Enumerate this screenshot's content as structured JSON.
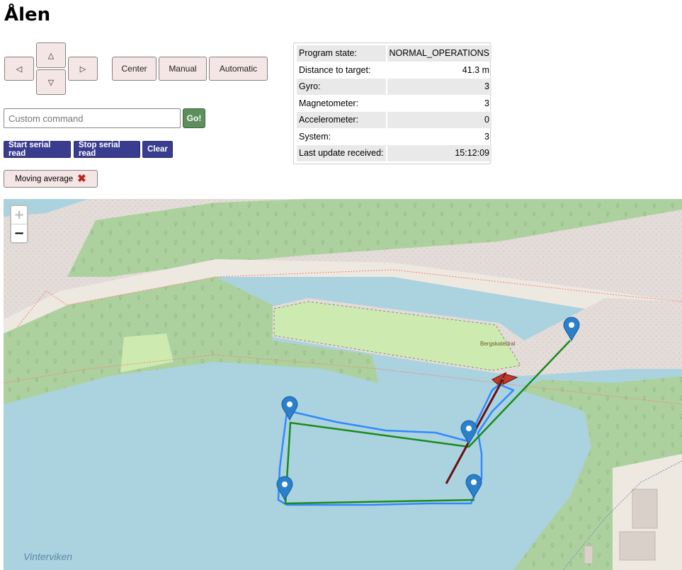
{
  "title": "Ålen",
  "controls": {
    "left_arrow": "◁",
    "up_arrow": "△",
    "down_arrow": "▽",
    "right_arrow": "▷",
    "center_label": "Center",
    "manual_label": "Manual",
    "automatic_label": "Automatic"
  },
  "command": {
    "placeholder": "Custom command",
    "go_label": "Go!"
  },
  "serial": {
    "start_label": "Start serial read",
    "stop_label": "Stop serial read",
    "clear_label": "Clear"
  },
  "moving_average": {
    "label": "Moving average",
    "icon": "close-icon"
  },
  "status": {
    "rows": [
      {
        "label": "Program state:",
        "value": "NORMAL_OPERATIONS"
      },
      {
        "label": "Distance to target:",
        "value": "41.3 m"
      },
      {
        "label": "Gyro:",
        "value": "3"
      },
      {
        "label": "Magnetometer:",
        "value": "3"
      },
      {
        "label": "Accelerometer:",
        "value": "0"
      },
      {
        "label": "System:",
        "value": "3"
      },
      {
        "label": "Last update received:",
        "value": "15:12:09"
      }
    ]
  },
  "map": {
    "zoom_in": "+",
    "zoom_out": "−",
    "place_label": "Vinterviken",
    "poi_label": "Bergskatedral",
    "colors": {
      "water": "#aad3df",
      "forest": "#add19e",
      "rock": "#e3dcd9",
      "planned_route": "#1a8a1a",
      "track": "#3388ff",
      "heading": "#6b0f0f",
      "marker": "#2a81cb"
    }
  }
}
